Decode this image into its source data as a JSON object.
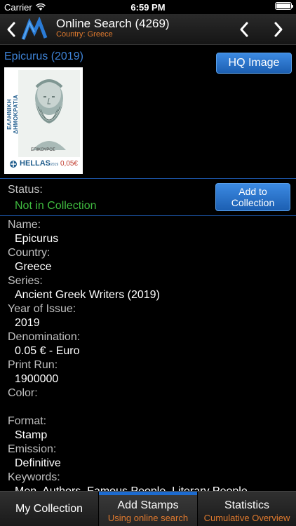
{
  "status_bar": {
    "carrier": "Carrier",
    "time": "6:59 PM"
  },
  "nav": {
    "title": "Online Search (4269)",
    "subtitle": "Country: Greece",
    "icons": [
      "chevron-left-icon",
      "app-logo",
      "chevron-left-icon",
      "chevron-right-icon"
    ]
  },
  "stamp": {
    "title": "Epicurus (2019)",
    "hq_button": "HQ Image",
    "image": {
      "side_text": "ΕΛΛΗΝΙΚΗ ΔΗΜΟΚΡΑΤΙΑ",
      "caption": "ΕΠΙΚΟΥΡΟΣ",
      "country": "HELLAS",
      "year": "2019",
      "value": "0,05€"
    }
  },
  "status": {
    "label": "Status:",
    "value": "Not in Collection",
    "add_button": "Add to Collection"
  },
  "details": [
    {
      "label": "Name:",
      "value": "Epicurus"
    },
    {
      "label": "Country:",
      "value": "Greece"
    },
    {
      "label": "Series:",
      "value": "Ancient Greek Writers (2019)"
    },
    {
      "label": "Year of Issue:",
      "value": "2019"
    },
    {
      "label": "Denomination:",
      "value": "0.05 € - Euro"
    },
    {
      "label": "Print Run:",
      "value": "1900000"
    },
    {
      "label": "Color:",
      "value": ""
    },
    {
      "label": "Format:",
      "value": "Stamp"
    },
    {
      "label": "Emission:",
      "value": "Definitive"
    },
    {
      "label": "Keywords:",
      "value": "Men, Authors, Famous People, Literary People"
    }
  ],
  "tabs": [
    {
      "label": "My Collection",
      "sub": ""
    },
    {
      "label": "Add Stamps",
      "sub": "Using online search",
      "active": true
    },
    {
      "label": "Statistics",
      "sub": "Cumulative Overview"
    }
  ],
  "colors": {
    "accent_blue": "#3f84d8",
    "status_green": "#3fbb3f",
    "subtitle_orange": "#e07a2e",
    "divider_blue": "#1a4f9c"
  }
}
